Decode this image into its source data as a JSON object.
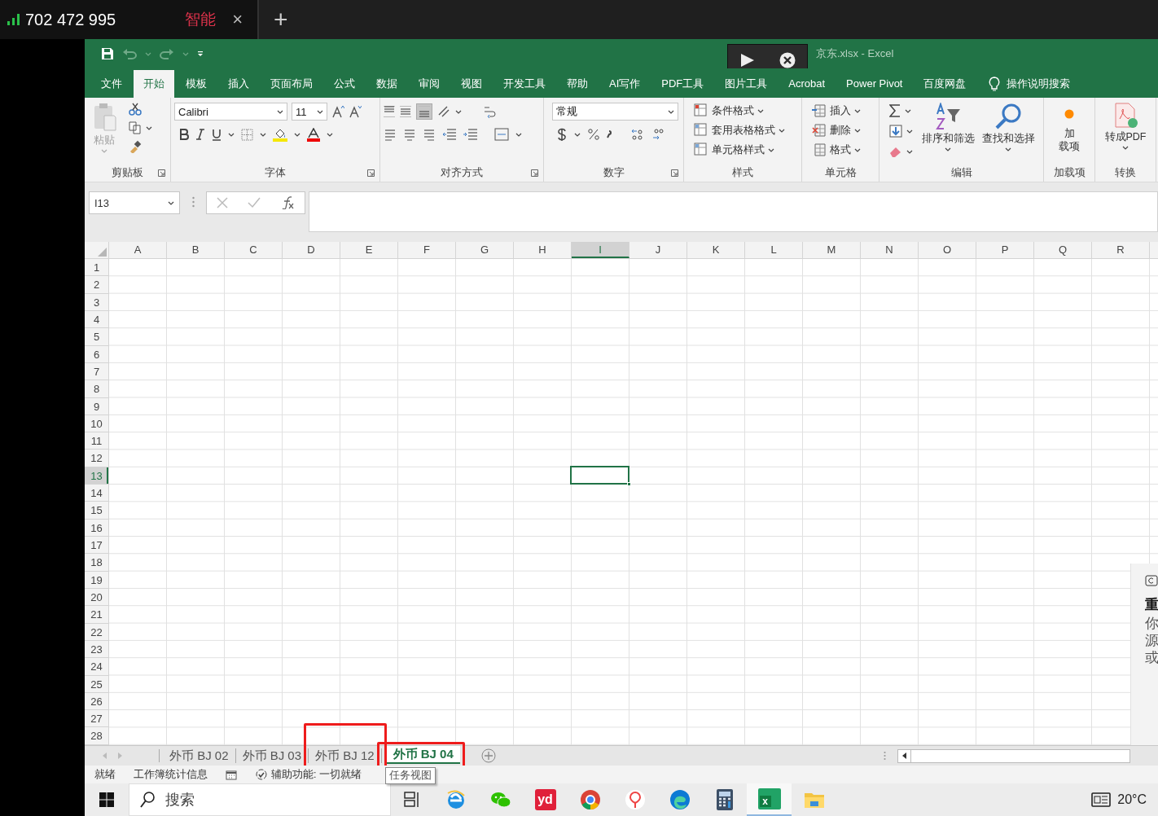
{
  "phone_bar": {
    "number": "702 472 995",
    "mode": "智能",
    "close": "×",
    "add": "+"
  },
  "title_bar": {
    "title": "京东.xlsx - Excel"
  },
  "ribbon_tabs": [
    {
      "label": "文件",
      "selected": false
    },
    {
      "label": "开始",
      "selected": true
    },
    {
      "label": "模板",
      "selected": false
    },
    {
      "label": "插入",
      "selected": false
    },
    {
      "label": "页面布局",
      "selected": false
    },
    {
      "label": "公式",
      "selected": false
    },
    {
      "label": "数据",
      "selected": false
    },
    {
      "label": "审阅",
      "selected": false
    },
    {
      "label": "视图",
      "selected": false
    },
    {
      "label": "开发工具",
      "selected": false
    },
    {
      "label": "帮助",
      "selected": false
    },
    {
      "label": "AI写作",
      "selected": false
    },
    {
      "label": "PDF工具",
      "selected": false
    },
    {
      "label": "图片工具",
      "selected": false
    },
    {
      "label": "Acrobat",
      "selected": false
    },
    {
      "label": "Power Pivot",
      "selected": false
    },
    {
      "label": "百度网盘",
      "selected": false
    }
  ],
  "tell_me": "操作说明搜索",
  "ribbon": {
    "clipboard": {
      "paste": "粘贴",
      "paste_disabled": true,
      "name": "剪贴板"
    },
    "font": {
      "font_name": "Calibri",
      "font_size": "11",
      "name": "字体"
    },
    "alignment": {
      "vertical_align": [
        {
          "kind": "top",
          "selected": false
        },
        {
          "kind": "middle",
          "selected": false
        },
        {
          "kind": "bottom",
          "selected": true
        }
      ],
      "name": "对齐方式"
    },
    "number": {
      "format": "常规",
      "name": "数字"
    },
    "styles": {
      "items": [
        "条件格式",
        "套用表格格式",
        "单元格样式"
      ],
      "name": "样式"
    },
    "cells": {
      "items": [
        "插入",
        "删除",
        "格式"
      ],
      "name": "单元格"
    },
    "editing": {
      "sort": "排序和筛选",
      "find": "查找和选择",
      "name": "编辑"
    },
    "addins": {
      "lines": [
        "加",
        "载项"
      ],
      "name": "加载项"
    },
    "convert": {
      "label": "转成PDF",
      "name": "转换"
    }
  },
  "formula_bar": {
    "name_box": "I13"
  },
  "sheet": {
    "columns": [
      {
        "label": "A",
        "selected": false
      },
      {
        "label": "B",
        "selected": false
      },
      {
        "label": "C",
        "selected": false
      },
      {
        "label": "D",
        "selected": false
      },
      {
        "label": "E",
        "selected": false
      },
      {
        "label": "F",
        "selected": false
      },
      {
        "label": "G",
        "selected": false
      },
      {
        "label": "H",
        "selected": false
      },
      {
        "label": "I",
        "selected": true
      },
      {
        "label": "J",
        "selected": false
      },
      {
        "label": "K",
        "selected": false
      },
      {
        "label": "L",
        "selected": false
      },
      {
        "label": "M",
        "selected": false
      },
      {
        "label": "N",
        "selected": false
      },
      {
        "label": "O",
        "selected": false
      },
      {
        "label": "P",
        "selected": false
      },
      {
        "label": "Q",
        "selected": false
      },
      {
        "label": "R",
        "selected": false
      }
    ],
    "rows": [
      {
        "label": "1",
        "selected": false
      },
      {
        "label": "2",
        "selected": false
      },
      {
        "label": "3",
        "selected": false
      },
      {
        "label": "4",
        "selected": false
      },
      {
        "label": "5",
        "selected": false
      },
      {
        "label": "6",
        "selected": false
      },
      {
        "label": "7",
        "selected": false
      },
      {
        "label": "8",
        "selected": false
      },
      {
        "label": "9",
        "selected": false
      },
      {
        "label": "10",
        "selected": false
      },
      {
        "label": "11",
        "selected": false
      },
      {
        "label": "12",
        "selected": false
      },
      {
        "label": "13",
        "selected": true
      },
      {
        "label": "14",
        "selected": false
      },
      {
        "label": "15",
        "selected": false
      },
      {
        "label": "16",
        "selected": false
      },
      {
        "label": "17",
        "selected": false
      },
      {
        "label": "18",
        "selected": false
      },
      {
        "label": "19",
        "selected": false
      },
      {
        "label": "20",
        "selected": false
      },
      {
        "label": "21",
        "selected": false
      },
      {
        "label": "22",
        "selected": false
      },
      {
        "label": "23",
        "selected": false
      },
      {
        "label": "24",
        "selected": false
      },
      {
        "label": "25",
        "selected": false
      },
      {
        "label": "26",
        "selected": false
      },
      {
        "label": "27",
        "selected": false
      },
      {
        "label": "28",
        "selected": false
      }
    ]
  },
  "sheet_tabs": [
    {
      "label": "外币 BJ 02",
      "selected": false,
      "annotated": false
    },
    {
      "label": "外币 BJ 03",
      "selected": false,
      "annotated": false
    },
    {
      "label": "外币 BJ 12",
      "selected": false,
      "annotated": true
    },
    {
      "label": "外币 BJ 04",
      "selected": true,
      "annotated": true
    }
  ],
  "status_bar": {
    "ready": "就绪",
    "stats": "工作簿统计信息",
    "accessibility": "辅助功能: 一切就绪"
  },
  "tooltip": "任务视图",
  "side_panel": {
    "lines": [
      {
        "text": "重",
        "kind": "heading"
      },
      {
        "text": "你",
        "kind": "body"
      },
      {
        "text": "源",
        "kind": "body"
      },
      {
        "text": "或",
        "kind": "body"
      }
    ]
  },
  "taskbar": {
    "search": {
      "placeholder": "搜索"
    },
    "apps": [
      {
        "kind": "ie",
        "selected": false
      },
      {
        "kind": "wechat",
        "selected": false
      },
      {
        "kind": "youdao",
        "label": "yd",
        "selected": false
      },
      {
        "kind": "chrome",
        "selected": false
      },
      {
        "kind": "pin",
        "selected": false
      },
      {
        "kind": "edge",
        "selected": false
      },
      {
        "kind": "calculator",
        "selected": false
      },
      {
        "kind": "excel",
        "label": "x",
        "selected": true
      },
      {
        "kind": "folder",
        "selected": false
      }
    ],
    "temperature": "20°C"
  }
}
